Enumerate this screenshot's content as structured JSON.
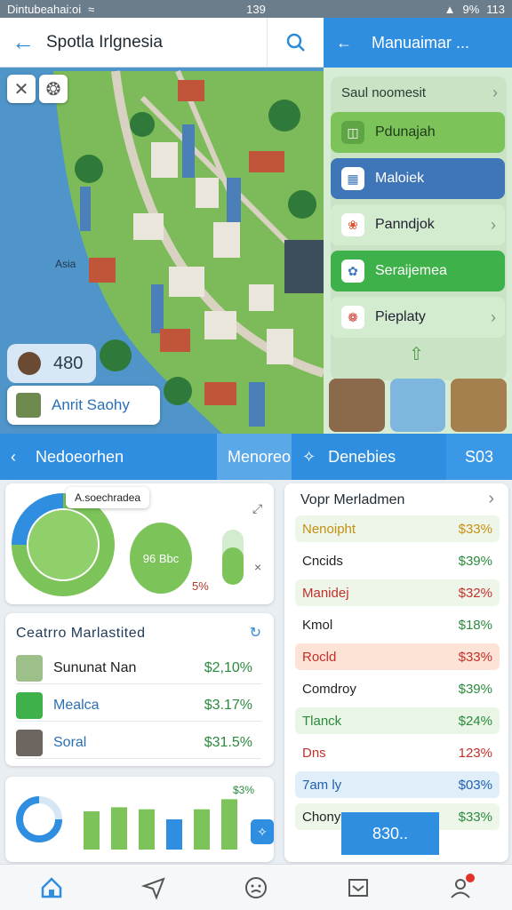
{
  "status_bar": {
    "left_text": "Dintubeahai:oi",
    "time": "139",
    "battery": "9%",
    "right_text": "113"
  },
  "search": {
    "title": "Spotla Irlgnesia"
  },
  "map": {
    "label_water": "Asia",
    "badge": "🐬",
    "chips": {
      "score": "480",
      "place": "Anrit Saohy"
    }
  },
  "right_panel": {
    "header": "Manuaimar ...",
    "section_title": "Saul noomesit",
    "items": [
      {
        "label": "Pdunajah",
        "icon": "bag-icon",
        "color": "#7cc35a"
      },
      {
        "label": "Maloiek",
        "icon": "document-icon",
        "color": "#3f76b8"
      },
      {
        "label": "Panndjok",
        "icon": "pinwheel-icon",
        "color": "#d3ebcf"
      },
      {
        "label": "Seraijemea",
        "icon": "flower-icon",
        "color": "#3fb14a"
      },
      {
        "label": "Pieplaty",
        "icon": "rose-icon",
        "color": "#d3ebcf"
      }
    ]
  },
  "sub_header": {
    "left": "Nedoeorhen",
    "tab": "Menoreo",
    "right": "Denebies",
    "right_value": "S03"
  },
  "chart_card": {
    "tooltip": "A.soechradea",
    "inner_label": "96 Bbc",
    "pct_label": "5%",
    "close": "×",
    "expand": "⤢"
  },
  "chart_data": {
    "type": "pie",
    "values": [
      75,
      25
    ]
  },
  "list_card": {
    "title": "Ceatrro Marlastited",
    "rows": [
      {
        "label": "Sununat Nan",
        "value": "$2,10%"
      },
      {
        "label": "Mealca",
        "value": "$3.17%"
      },
      {
        "label": "Soral",
        "value": "$31.5%"
      }
    ]
  },
  "bar_card": {
    "label_top": "$3%",
    "bars": [
      38,
      42,
      40,
      30,
      40,
      50
    ]
  },
  "table_card": {
    "title": "Vopr Merladmen",
    "rows": [
      {
        "label": "Nenoipht",
        "value": "$33%",
        "color": "#c58f10",
        "bg": "#eef6ea"
      },
      {
        "label": "Cncids",
        "value": "$39%",
        "color": "#222",
        "bg": "#fff"
      },
      {
        "label": "Manidej",
        "value": "$32%",
        "color": "#c1312b",
        "bg": "#eef6ea"
      },
      {
        "label": "Kmol",
        "value": "$18%",
        "color": "#222",
        "bg": "#fff"
      },
      {
        "label": "Rocld",
        "value": "$33%",
        "color": "#c1312b",
        "bg": "#fde2d6"
      },
      {
        "label": "Comdroy",
        "value": "$39%",
        "color": "#222",
        "bg": "#fff"
      },
      {
        "label": "Tlanck",
        "value": "$24%",
        "color": "#2b8a3e",
        "bg": "#e9f5e5"
      },
      {
        "label": "Dns",
        "value": "123%",
        "color": "#c1312b",
        "bg": "#fff"
      },
      {
        "label": "7am ly",
        "value": "$03%",
        "color": "#2060b0",
        "bg": "#e0eef9"
      },
      {
        "label": "Chony",
        "value": "$33%",
        "color": "#222",
        "bg": "#eef6ea"
      }
    ],
    "overlay_value": "830.."
  },
  "bottom_nav": [
    {
      "name": "home",
      "icon": "home-icon"
    },
    {
      "name": "send",
      "icon": "send-icon"
    },
    {
      "name": "face",
      "icon": "face-icon"
    },
    {
      "name": "inbox",
      "icon": "inbox-icon"
    },
    {
      "name": "profile",
      "icon": "profile-icon"
    }
  ]
}
